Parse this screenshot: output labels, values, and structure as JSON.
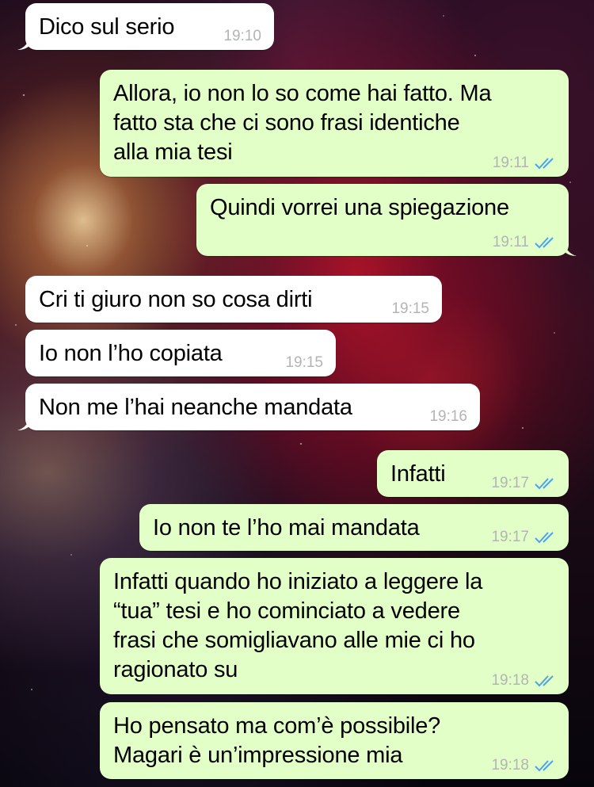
{
  "messages": [
    {
      "direction": "in",
      "text": "Dico sul serio",
      "time": "19:10",
      "ticks": ""
    },
    {
      "direction": "out",
      "text": "Allora, io non lo so come hai fatto. Ma\nfatto sta che ci sono frasi identiche\nalla mia tesi",
      "time": "19:11",
      "ticks": "double-check-icon"
    },
    {
      "direction": "out",
      "text": "Quindi vorrei una spiegazione",
      "time": "19:11",
      "ticks": "double-check-icon"
    },
    {
      "direction": "in",
      "text": "Cri ti giuro non so cosa dirti",
      "time": "19:15",
      "ticks": ""
    },
    {
      "direction": "in",
      "text": "Io non l’ho copiata",
      "time": "19:15",
      "ticks": ""
    },
    {
      "direction": "in",
      "text": "Non me l’hai neanche mandata",
      "time": "19:16",
      "ticks": ""
    },
    {
      "direction": "out",
      "text": "Infatti",
      "time": "19:17",
      "ticks": "double-check-icon"
    },
    {
      "direction": "out",
      "text": "Io non te l’ho mai mandata",
      "time": "19:17",
      "ticks": "double-check-icon"
    },
    {
      "direction": "out",
      "text": "Infatti quando ho iniziato a leggere la\n“tua” tesi e ho cominciato a vedere\nfrasi che somigliavano alle mie ci ho\nragionato su",
      "time": "19:18",
      "ticks": "double-check-icon"
    },
    {
      "direction": "out",
      "text": "Ho pensato ma com’è possibile?\nMagari è un’impressione mia",
      "time": "19:18",
      "ticks": "double-check-icon"
    }
  ],
  "colors": {
    "incoming_bubble": "#ffffff",
    "outgoing_bubble": "#e1ffc7",
    "timestamp": "#b4b4b4",
    "read_ticks": "#4fa3e6"
  }
}
